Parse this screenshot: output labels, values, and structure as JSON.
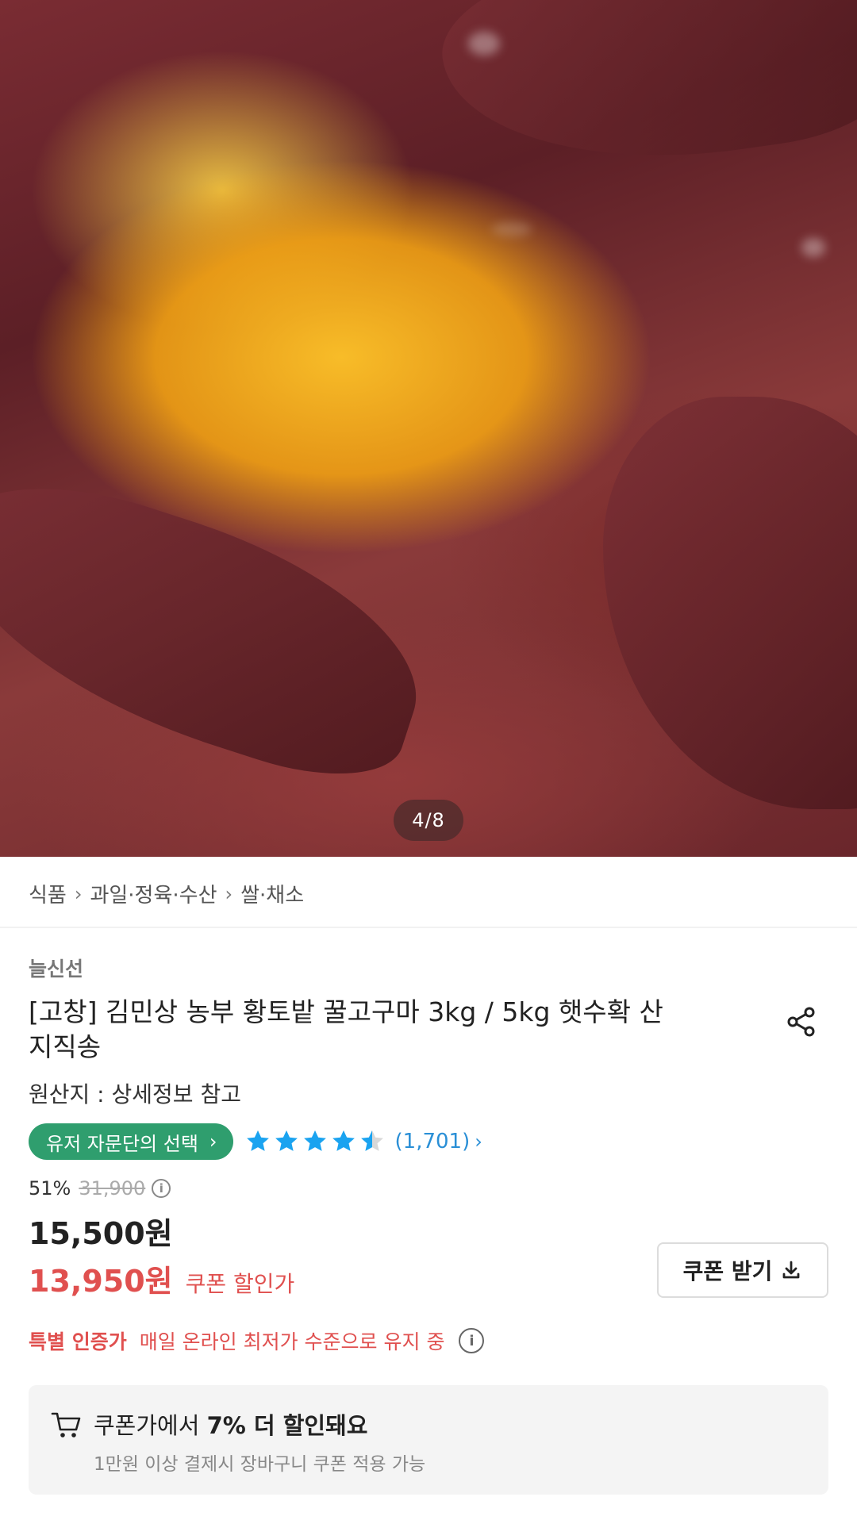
{
  "hero": {
    "image_alt": "roasted sweet potato",
    "counter": "4/8"
  },
  "breadcrumb": [
    "식품",
    "과일·정육·수산",
    "쌀·채소"
  ],
  "product": {
    "seller": "늘신선",
    "title": "[고창] 김민상 농부 황토밭 꿀고구마 3kg / 5kg 햇수확 산지직송",
    "origin": "원산지 : 상세정보 참고",
    "badge": "유저 자문단의 선택",
    "rating_count": "(1,701)",
    "rating": 4.5
  },
  "price": {
    "discount": "51%",
    "original": "31,900",
    "sale": "15,500원",
    "coupon_price": "13,950원",
    "coupon_label": "쿠폰 할인가",
    "coupon_button": "쿠폰 받기"
  },
  "special": {
    "label": "특별 인증가",
    "text": "매일 온라인 최저가 수준으로 유지 중"
  },
  "cart_coupon": {
    "line1_prefix": "쿠폰가에서 ",
    "line1_bold": "7% 더 할인돼요",
    "line2": "1만원 이상 결제시 장바구니 쿠폰 적용 가능"
  },
  "colors": {
    "badge_green": "#2f9e6e",
    "star_blue": "#1aa3f0",
    "accent_red": "#e0504f",
    "link_blue": "#2a8fd6"
  }
}
